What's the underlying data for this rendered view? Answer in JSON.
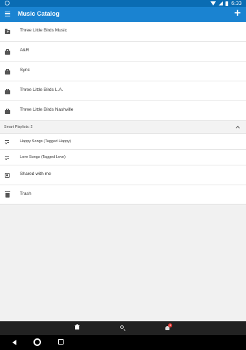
{
  "status_bar": {
    "time": "6:33"
  },
  "app_bar": {
    "title": "Music Catalog"
  },
  "catalog_items": [
    {
      "label": "Three Little Birds Music",
      "icon": "folder-add-icon"
    },
    {
      "label": "A&R",
      "icon": "briefcase-icon"
    },
    {
      "label": "Sync",
      "icon": "briefcase-icon"
    },
    {
      "label": "Three Little Birds L.A.",
      "icon": "briefcase-icon"
    },
    {
      "label": "Three Little Birds Nashville",
      "icon": "briefcase-icon"
    }
  ],
  "smart_playlists": {
    "header": "Smart Playlists: 2",
    "items": [
      {
        "label": "Happy Songs (Tagged Happy)",
        "icon": "smart-playlist-icon"
      },
      {
        "label": "Love Songs (Tagged Love)",
        "icon": "smart-playlist-icon"
      }
    ]
  },
  "other_items": [
    {
      "label": "Shared with me",
      "icon": "shared-icon"
    },
    {
      "label": "Trash",
      "icon": "trash-icon"
    }
  ],
  "bottom_nav": {
    "notification_count": "4"
  }
}
